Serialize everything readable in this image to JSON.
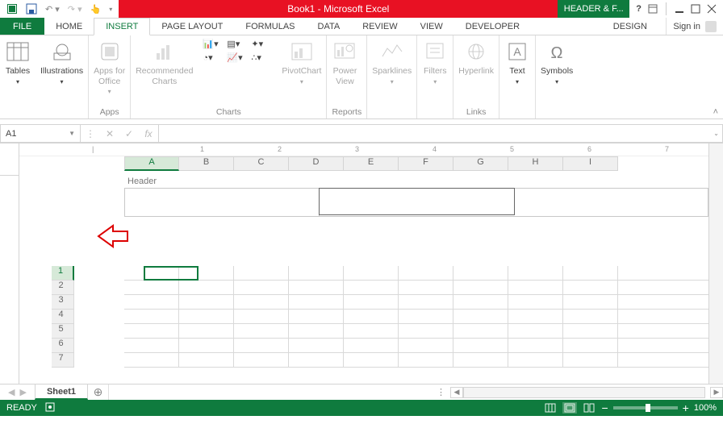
{
  "title": "Book1 - Microsoft Excel",
  "context_tab": "HEADER & F...",
  "tabs": {
    "file": "FILE",
    "home": "HOME",
    "insert": "INSERT",
    "page_layout": "PAGE LAYOUT",
    "formulas": "FORMULAS",
    "data": "DATA",
    "review": "REVIEW",
    "view": "VIEW",
    "developer": "DEVELOPER",
    "design": "DESIGN"
  },
  "signin": "Sign in",
  "ribbon": {
    "groups": {
      "tables": {
        "btn": "Tables",
        "label": ""
      },
      "illustrations": {
        "btn": "Illustrations",
        "label": ""
      },
      "apps": {
        "btn": "Apps for\nOffice",
        "label": "Apps"
      },
      "charts": {
        "rec": "Recommended\nCharts",
        "pivot": "PivotChart",
        "label": "Charts"
      },
      "reports": {
        "btn": "Power\nView",
        "label": "Reports"
      },
      "sparklines": {
        "btn": "Sparklines",
        "label": ""
      },
      "filters": {
        "btn": "Filters",
        "label": ""
      },
      "links": {
        "btn": "Hyperlink",
        "label": "Links"
      },
      "text": {
        "btn": "Text",
        "label": ""
      },
      "symbols": {
        "btn": "Symbols",
        "label": ""
      }
    }
  },
  "namebox": "A1",
  "fx": {
    "cancel": "✕",
    "enter": "✓",
    "fx": "fx"
  },
  "columns": [
    "A",
    "B",
    "C",
    "D",
    "E",
    "F",
    "G",
    "H",
    "I"
  ],
  "rows": [
    "1",
    "2",
    "3",
    "4",
    "5",
    "6",
    "7"
  ],
  "header_label": "Header",
  "sheet_tab": "Sheet1",
  "status": {
    "ready": "READY",
    "zoom": "100%",
    "minus": "−",
    "plus": "+"
  },
  "ruler": [
    "1",
    "2",
    "3",
    "4",
    "5",
    "6",
    "7"
  ]
}
